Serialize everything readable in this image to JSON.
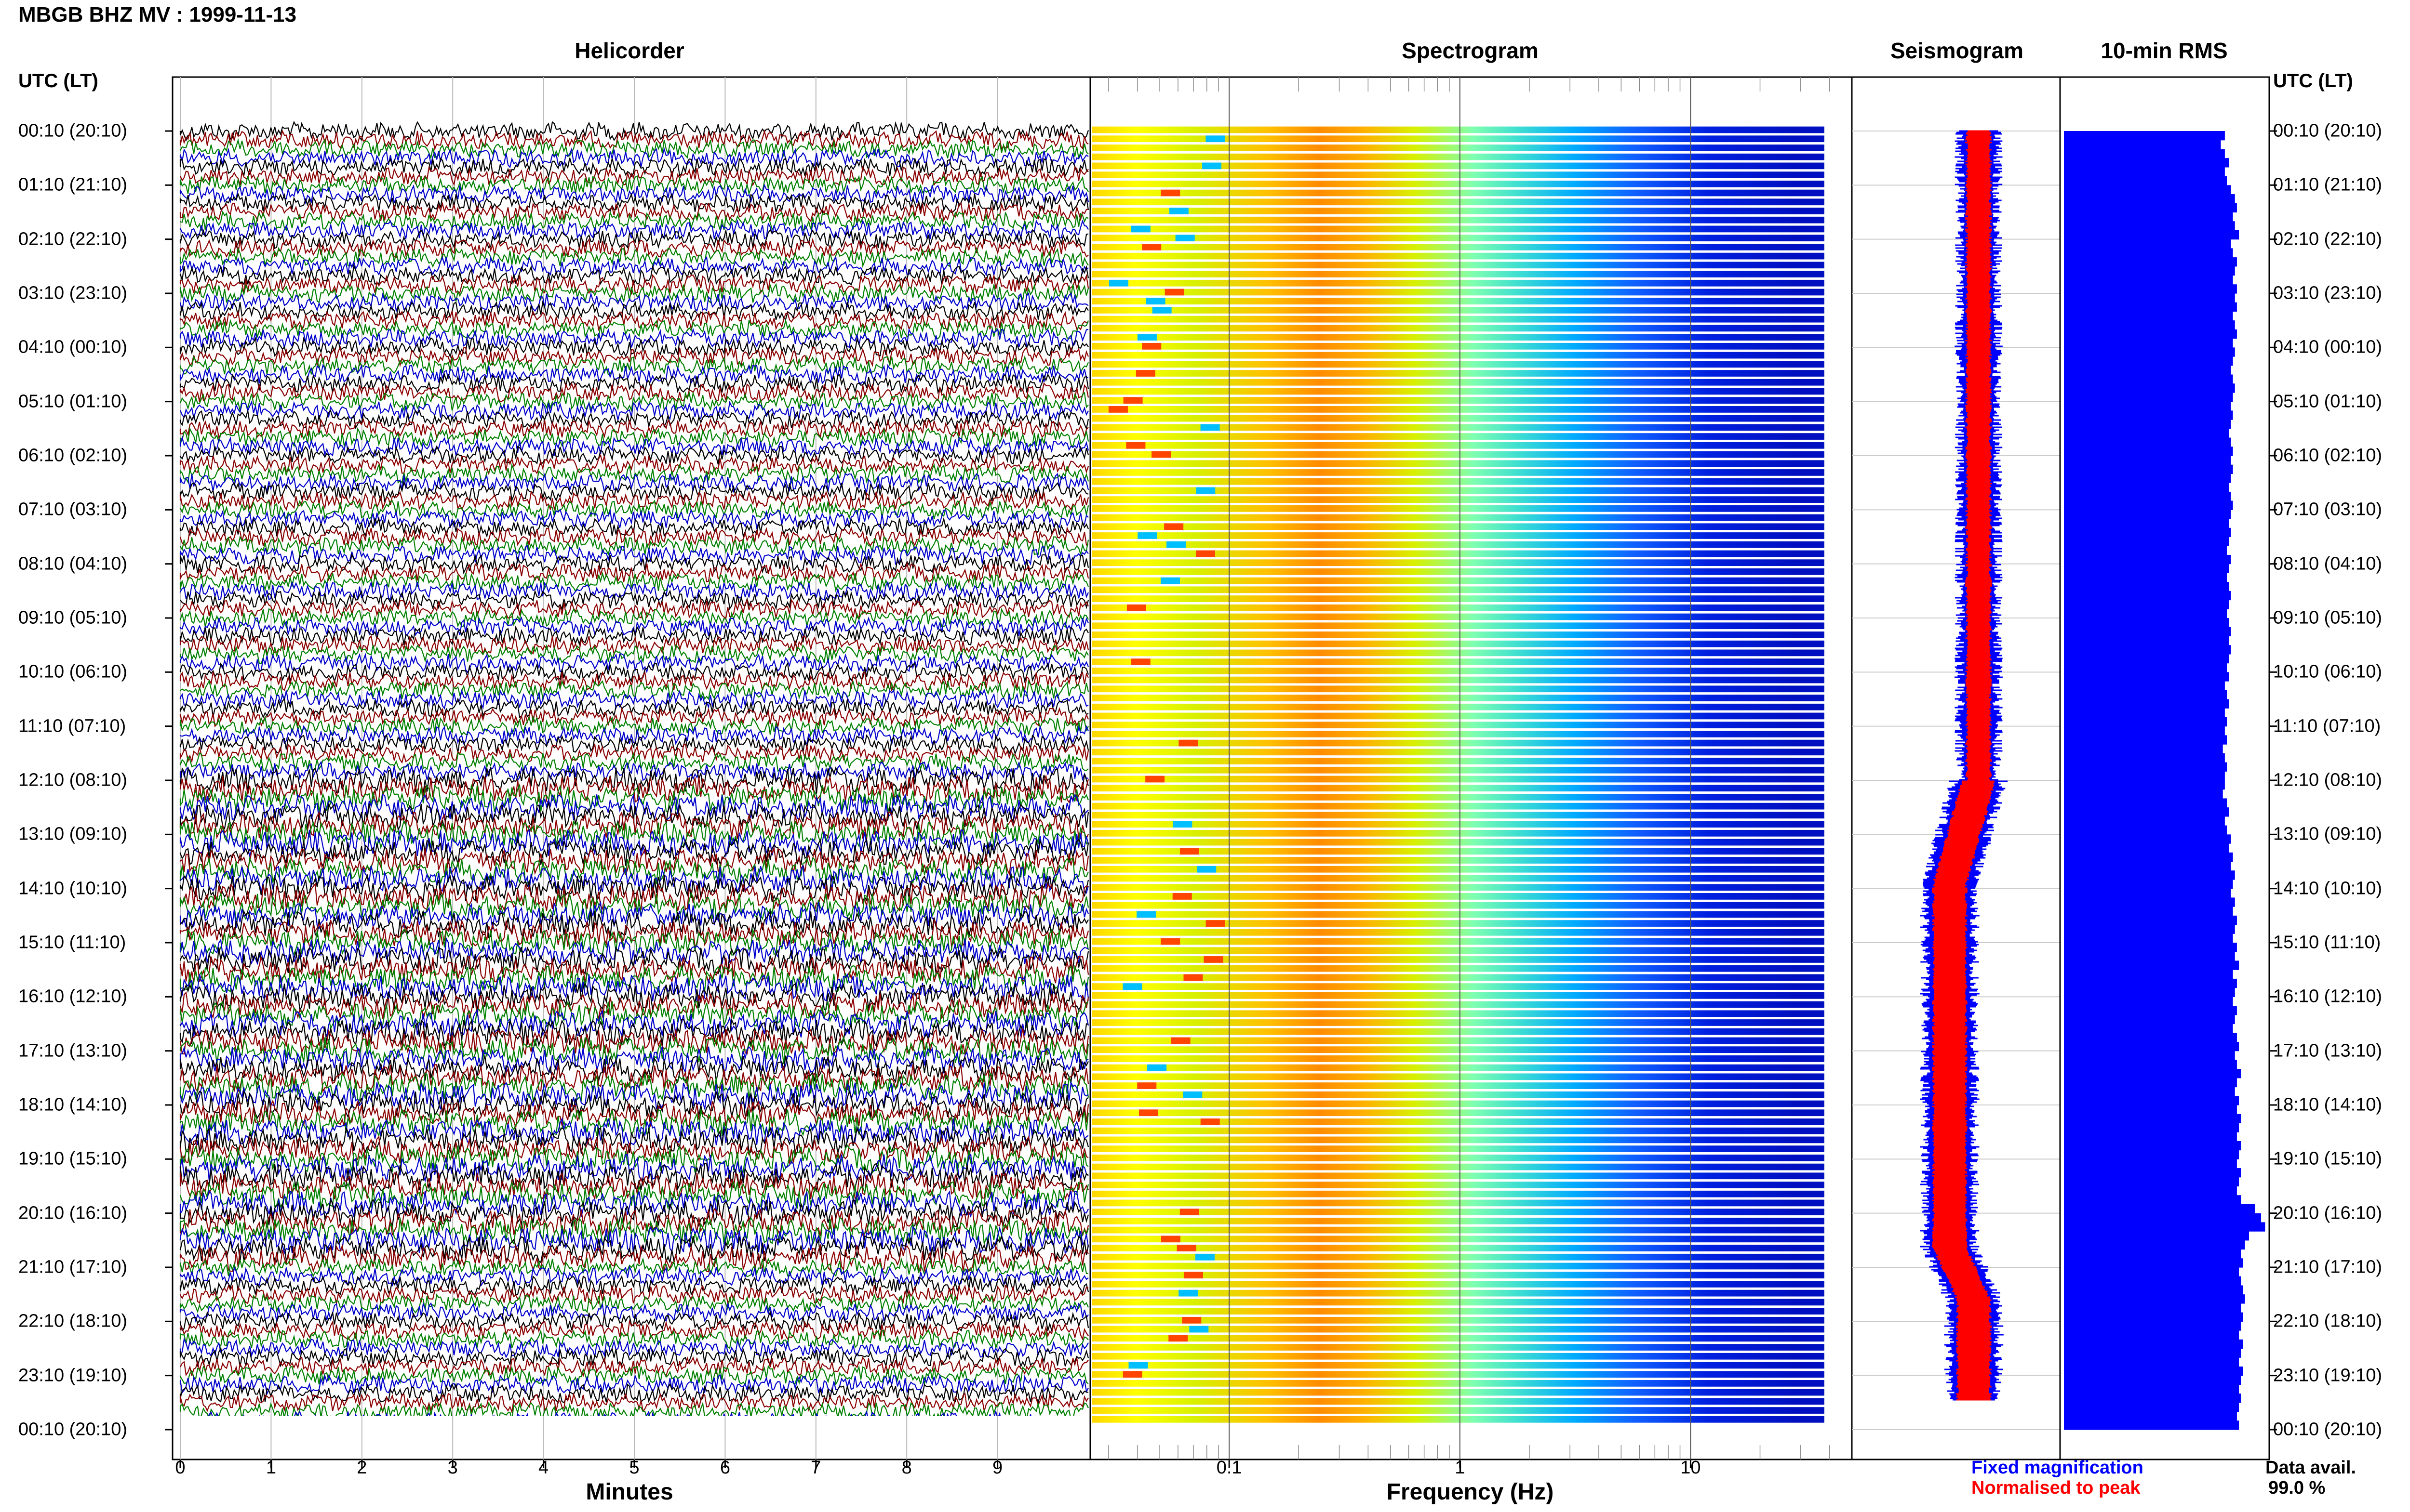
{
  "page_title": "MBGB BHZ MV : 1999-11-13",
  "panels": {
    "helicorder": "Helicorder",
    "spectrogram": "Spectrogram",
    "seismogram": "Seismogram",
    "rms": "10-min RMS"
  },
  "utc_header_left": "UTC (LT)",
  "utc_header_right": "UTC (LT)",
  "row_labels": [
    "00:10 (20:10)",
    "01:10 (21:10)",
    "02:10 (22:10)",
    "03:10 (23:10)",
    "04:10 (00:10)",
    "05:10 (01:10)",
    "06:10 (02:10)",
    "07:10 (03:10)",
    "08:10 (04:10)",
    "09:10 (05:10)",
    "10:10 (06:10)",
    "11:10 (07:10)",
    "12:10 (08:10)",
    "13:10 (09:10)",
    "14:10 (10:10)",
    "15:10 (11:10)",
    "16:10 (12:10)",
    "17:10 (13:10)",
    "18:10 (14:10)",
    "19:10 (15:10)",
    "20:10 (16:10)",
    "21:10 (17:10)",
    "22:10 (18:10)",
    "23:10 (19:10)",
    "00:10 (20:10)"
  ],
  "legend": {
    "fixed": "Fixed magnification",
    "normalised": "Normalised to peak",
    "fixed_color": "#0000ff",
    "normalised_color": "#ff0000"
  },
  "data_avail_label": "Data avail.",
  "data_avail_value": "99.0 %",
  "chart_data": [
    {
      "type": "line",
      "panel": "helicorder",
      "xlabel": "Minutes",
      "xlim": [
        0,
        10
      ],
      "x_ticks": [
        "0",
        "1",
        "2",
        "3",
        "4",
        "5",
        "6",
        "7",
        "8",
        "9"
      ],
      "y_ticks": "row_labels",
      "traces_per_hour": 6,
      "trace_colors": [
        "#000000",
        "#8b0000",
        "#008000",
        "#0000cd"
      ],
      "grid": true
    },
    {
      "type": "heatmap",
      "panel": "spectrogram",
      "xlabel": "Frequency (Hz)",
      "x_scale": "log",
      "xlim": [
        0.025,
        50
      ],
      "x_ticks": [
        "0.1",
        "1",
        "10"
      ],
      "colormap": [
        "#ffff00",
        "#ffa500",
        "#ff4500",
        "#7fffd4",
        "#00bfff",
        "#0000ff",
        "#00008b"
      ],
      "grid": true
    },
    {
      "type": "line",
      "panel": "seismogram",
      "series": [
        {
          "name": "Fixed magnification",
          "color": "#0000ff"
        },
        {
          "name": "Normalised to peak",
          "color": "#ff0000"
        }
      ],
      "grid": true
    },
    {
      "type": "bar",
      "panel": "rms",
      "orientation": "horizontal",
      "bar_color": "#0000ff",
      "count": 144,
      "values": [
        0.8,
        0.78,
        0.8,
        0.82,
        0.8,
        0.81,
        0.83,
        0.85,
        0.86,
        0.84,
        0.85,
        0.87,
        0.83,
        0.84,
        0.86,
        0.85,
        0.84,
        0.86,
        0.85,
        0.86,
        0.84,
        0.85,
        0.86,
        0.84,
        0.85,
        0.84,
        0.83,
        0.84,
        0.85,
        0.84,
        0.83,
        0.84,
        0.83,
        0.82,
        0.83,
        0.84,
        0.83,
        0.84,
        0.83,
        0.82,
        0.83,
        0.84,
        0.83,
        0.82,
        0.83,
        0.82,
        0.81,
        0.83,
        0.82,
        0.81,
        0.82,
        0.83,
        0.82,
        0.81,
        0.82,
        0.83,
        0.82,
        0.83,
        0.82,
        0.81,
        0.82,
        0.8,
        0.81,
        0.82,
        0.8,
        0.81,
        0.8,
        0.81,
        0.79,
        0.8,
        0.81,
        0.8,
        0.8,
        0.79,
        0.81,
        0.82,
        0.8,
        0.81,
        0.83,
        0.82,
        0.84,
        0.83,
        0.85,
        0.84,
        0.83,
        0.85,
        0.84,
        0.86,
        0.85,
        0.84,
        0.86,
        0.85,
        0.87,
        0.84,
        0.86,
        0.85,
        0.84,
        0.86,
        0.85,
        0.84,
        0.86,
        0.87,
        0.85,
        0.86,
        0.88,
        0.86,
        0.85,
        0.87,
        0.86,
        0.88,
        0.87,
        0.86,
        0.88,
        0.87,
        0.86,
        0.88,
        0.87,
        0.86,
        0.88,
        0.95,
        0.98,
        1.0,
        0.92,
        0.9,
        0.88,
        0.89,
        0.87,
        0.88,
        0.89,
        0.9,
        0.88,
        0.89,
        0.88,
        0.87,
        0.89,
        0.88,
        0.87,
        0.89,
        0.88,
        0.87,
        0.88,
        0.87,
        0.86,
        0.87
      ]
    }
  ]
}
